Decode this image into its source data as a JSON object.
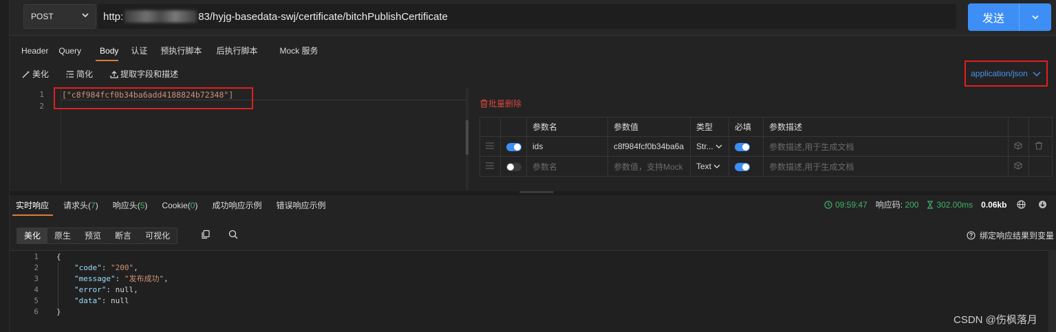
{
  "request": {
    "method": "POST",
    "url_prefix": "http:",
    "url_suffix": "83/hyjg-basedata-swj/certificate/bitchPublishCertificate",
    "send_label": "发送"
  },
  "request_tabs": [
    "Header",
    "Query",
    "Body",
    "认证",
    "预执行脚本",
    "后执行脚本",
    "Mock 服务"
  ],
  "active_request_tab": "Body",
  "body_tools": {
    "beautify": "美化",
    "simplify": "简化",
    "extract": "提取字段和描述"
  },
  "content_type": "application/json",
  "body_editor": {
    "line_numbers": [
      "1",
      "2"
    ],
    "line1": "[\"c8f984fcf0b34ba6add4188824b72348\"]"
  },
  "params": {
    "batch_delete": "批量删除",
    "headers": [
      "参数名",
      "参数值",
      "类型",
      "必填",
      "参数描述"
    ],
    "rows": [
      {
        "name": "ids",
        "value": "c8f984fcf0b34ba6a",
        "type": "Str...",
        "desc": "参数描述,用于生成文档",
        "enabled": true,
        "required": true
      },
      {
        "name": "参数名",
        "value": "参数值，支持Mock",
        "type": "Text",
        "desc": "参数描述,用于生成文档",
        "enabled": false,
        "required": true
      }
    ]
  },
  "response_tabs": [
    {
      "label": "实时响应",
      "count": ""
    },
    {
      "label": "请求头(",
      "count": "7",
      "close": ")"
    },
    {
      "label": "响应头(",
      "count": "5",
      "close": ")"
    },
    {
      "label": "Cookie(",
      "count": "0",
      "close": ")"
    },
    {
      "label": "成功响应示例",
      "count": ""
    },
    {
      "label": "错误响应示例",
      "count": ""
    }
  ],
  "response_meta": {
    "time": "09:59:47",
    "code_label": "响应码:",
    "code": "200",
    "duration": "302.00ms",
    "size": "0.06kb"
  },
  "view_tabs": [
    "美化",
    "原生",
    "预览",
    "断言",
    "可视化"
  ],
  "bind_var": "绑定响应结果到变量",
  "response_editor": {
    "line_numbers": [
      "1",
      "2",
      "3",
      "4",
      "5",
      "6"
    ],
    "open": "{",
    "close": "}",
    "lines": [
      {
        "key": "\"code\"",
        "val": "\"200\"",
        "val_type": "s",
        "comma": ","
      },
      {
        "key": "\"message\"",
        "val": "\"发布成功\"",
        "val_type": "s",
        "comma": ","
      },
      {
        "key": "\"error\"",
        "val": "null",
        "val_type": "n",
        "comma": ","
      },
      {
        "key": "\"data\"",
        "val": "null",
        "val_type": "n",
        "comma": ""
      }
    ]
  },
  "watermark": "CSDN @伤枫落月",
  "colors": {
    "accent": "#3d8ef5",
    "tab_underline": "#e07b38",
    "success": "#43b06a",
    "danger": "#d6463c",
    "highlight_box": "#e21f1f"
  }
}
